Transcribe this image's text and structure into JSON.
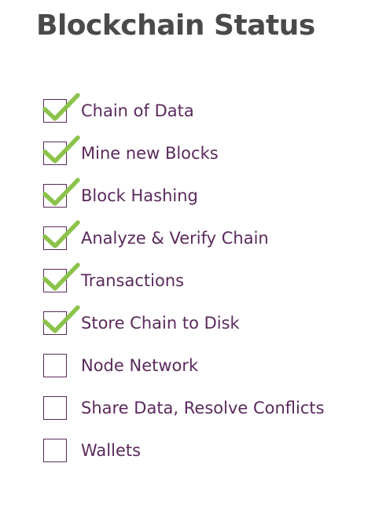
{
  "title": "Blockchain Status",
  "colors": {
    "title": "#4a4a4a",
    "text": "#5a2a5c",
    "box_border": "#5a2a5c",
    "check": "#8bc34a"
  },
  "items": [
    {
      "label": "Chain of Data",
      "checked": true
    },
    {
      "label": "Mine new Blocks",
      "checked": true
    },
    {
      "label": "Block Hashing",
      "checked": true
    },
    {
      "label": "Analyze & Verify Chain",
      "checked": true
    },
    {
      "label": "Transactions",
      "checked": true
    },
    {
      "label": "Store Chain to Disk",
      "checked": true
    },
    {
      "label": "Node Network",
      "checked": false
    },
    {
      "label": "Share Data, Resolve Conflicts",
      "checked": false
    },
    {
      "label": "Wallets",
      "checked": false
    }
  ]
}
